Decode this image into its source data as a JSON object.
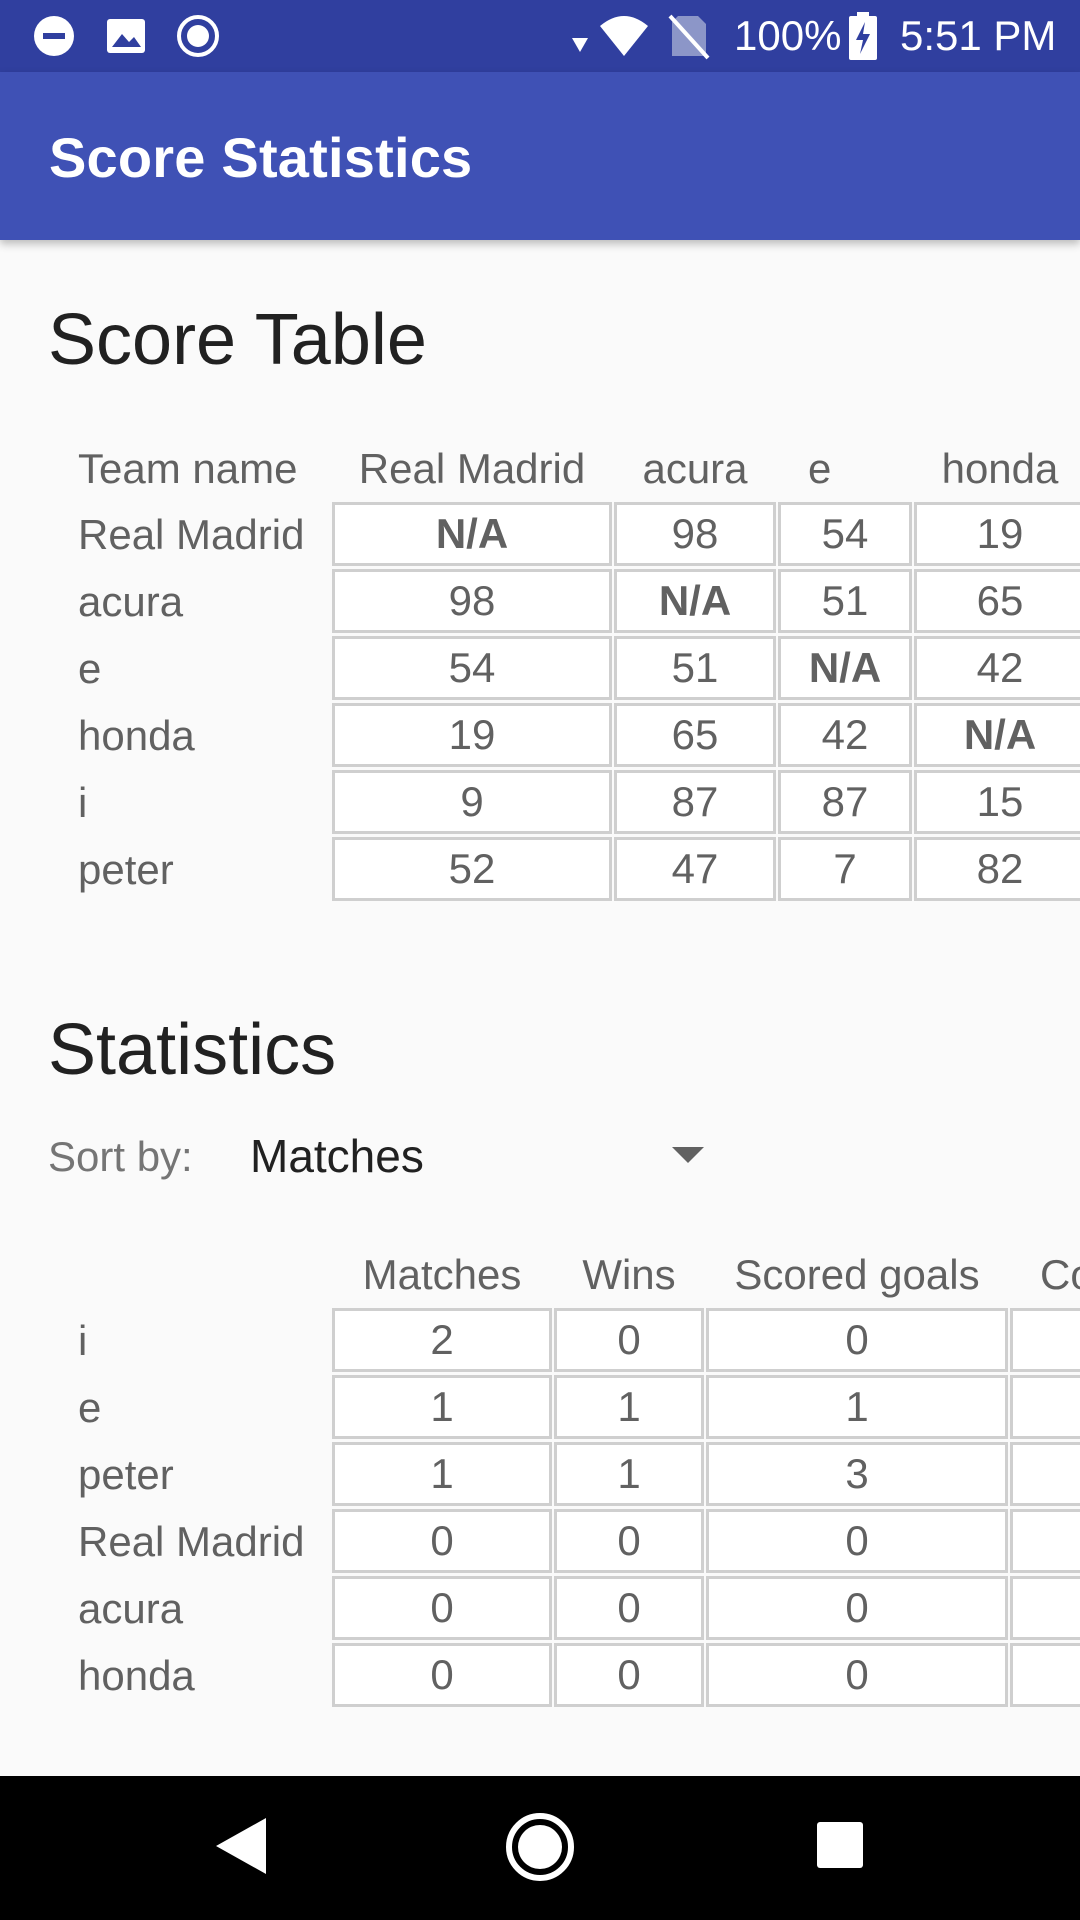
{
  "status_bar": {
    "battery": "100%",
    "time": "5:51 PM",
    "icons": [
      "do-not-disturb-icon",
      "image-icon",
      "record-icon",
      "wifi-icon",
      "no-sim-icon",
      "battery-charging-icon"
    ]
  },
  "app_bar": {
    "title": "Score Statistics"
  },
  "score_table": {
    "title": "Score Table",
    "corner_header": "Team name",
    "columns": [
      "Real Madrid",
      "acura",
      "e",
      "honda"
    ],
    "rows": [
      {
        "label": "Real Madrid",
        "cells": [
          "N/A",
          "98",
          "54",
          "19"
        ]
      },
      {
        "label": "acura",
        "cells": [
          "98",
          "N/A",
          "51",
          "65"
        ]
      },
      {
        "label": "e",
        "cells": [
          "54",
          "51",
          "N/A",
          "42"
        ]
      },
      {
        "label": "honda",
        "cells": [
          "19",
          "65",
          "42",
          "N/A"
        ]
      },
      {
        "label": "i",
        "cells": [
          "9",
          "87",
          "87",
          "15"
        ]
      },
      {
        "label": "peter",
        "cells": [
          "52",
          "47",
          "7",
          "82"
        ]
      }
    ]
  },
  "statistics": {
    "title": "Statistics",
    "sort_label": "Sort by:",
    "sort_value": "Matches",
    "columns": [
      "Matches",
      "Wins",
      "Scored goals",
      "Co"
    ],
    "rows": [
      {
        "label": "i",
        "cells": [
          "2",
          "0",
          "0",
          ""
        ]
      },
      {
        "label": "e",
        "cells": [
          "1",
          "1",
          "1",
          ""
        ]
      },
      {
        "label": "peter",
        "cells": [
          "1",
          "1",
          "3",
          ""
        ]
      },
      {
        "label": "Real Madrid",
        "cells": [
          "0",
          "0",
          "0",
          ""
        ]
      },
      {
        "label": "acura",
        "cells": [
          "0",
          "0",
          "0",
          ""
        ]
      },
      {
        "label": "honda",
        "cells": [
          "0",
          "0",
          "0",
          ""
        ]
      }
    ]
  },
  "nav_bar": {
    "icons": [
      "back-icon",
      "home-icon",
      "recents-icon"
    ]
  }
}
